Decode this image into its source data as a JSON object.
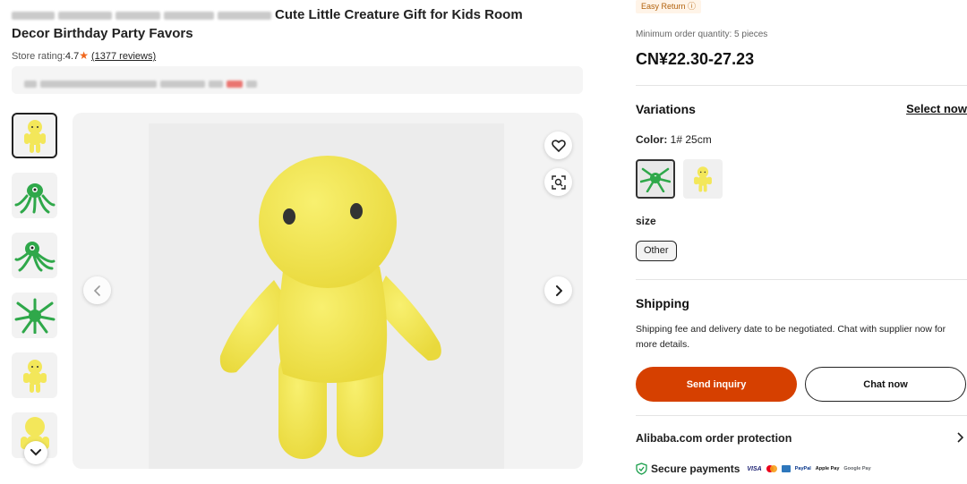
{
  "product": {
    "title_visible": "Cute Little Creature Gift for Kids Room",
    "title_line2": "Decor Birthday Party Favors",
    "store_rating_label": "Store rating:",
    "store_rating_value": "4.7",
    "reviews_link": "(1377 reviews)"
  },
  "gallery": {
    "thumbnails": [
      "yellow-plush",
      "green-octopus",
      "green-octopus-side",
      "green-octopus-top",
      "yellow-plush-small",
      "yellow-plush-large"
    ],
    "active_index": 0
  },
  "right_panel": {
    "easy_return": "Easy Return",
    "min_order": "Minimum order quantity: 5 pieces",
    "price": "CN¥22.30-27.23",
    "variations_title": "Variations",
    "select_now": "Select now",
    "color_label": "Color:",
    "color_value": "1# 25cm",
    "size_label": "size",
    "size_option": "Other",
    "shipping_title": "Shipping",
    "shipping_text": "Shipping fee and delivery date to be negotiated. Chat with supplier now for more details.",
    "send_inquiry": "Send inquiry",
    "chat_now": "Chat now",
    "order_protection": "Alibaba.com order protection",
    "secure_payments": "Secure payments",
    "payment_logos": [
      "VISA",
      "Mastercard",
      "Amex",
      "PayPal",
      "Apple Pay",
      "Google Pay"
    ]
  },
  "colors": {
    "accent": "#d64000",
    "plush_yellow": "#f3e75a",
    "octopus_green": "#2fa84a"
  }
}
